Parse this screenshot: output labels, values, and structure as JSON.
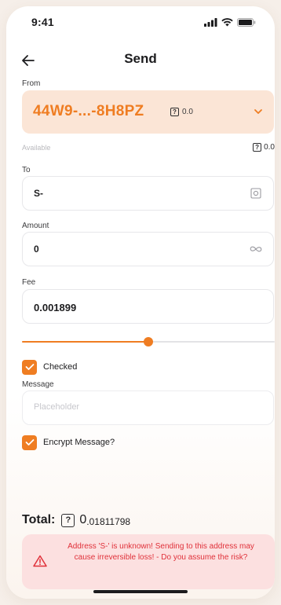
{
  "status_bar": {
    "time": "9:41"
  },
  "header": {
    "title": "Send"
  },
  "from": {
    "label": "From",
    "address": "44W9-...-8H8PZ",
    "token_symbol": "?",
    "balance": "0.0"
  },
  "available": {
    "label": "Available",
    "token_symbol": "?",
    "value": "0.0"
  },
  "to": {
    "label": "To",
    "value": "S-"
  },
  "amount": {
    "label": "Amount",
    "value": "0"
  },
  "fee": {
    "label": "Fee",
    "value": "0.001899",
    "slider_fraction": 0.5
  },
  "checked_option": {
    "label": "Checked",
    "checked": true
  },
  "message": {
    "label": "Message",
    "placeholder": "Placeholder"
  },
  "encrypt_option": {
    "label": "Encrypt Message?",
    "checked": true
  },
  "total": {
    "label": "Total:",
    "token_symbol": "?",
    "value_major": "0",
    "value_minor": ".01811798"
  },
  "warning": {
    "text": "Address 'S-' is unknown! Sending to this address may cause irreversible loss! - Do you assume the risk?"
  },
  "colors": {
    "accent": "#ef7d22",
    "from_card_bg": "#fbe5d6",
    "warning_bg": "#fce0e0",
    "warning_text": "#e0313a"
  },
  "icons": {
    "back": "arrow-left-icon",
    "chevron": "chevron-down-icon",
    "qr_scan": "qr-scan-icon",
    "infinity": "infinity-icon",
    "warning": "warning-triangle-icon",
    "signal": "signal-icon",
    "wifi": "wifi-icon",
    "battery": "battery-icon"
  }
}
